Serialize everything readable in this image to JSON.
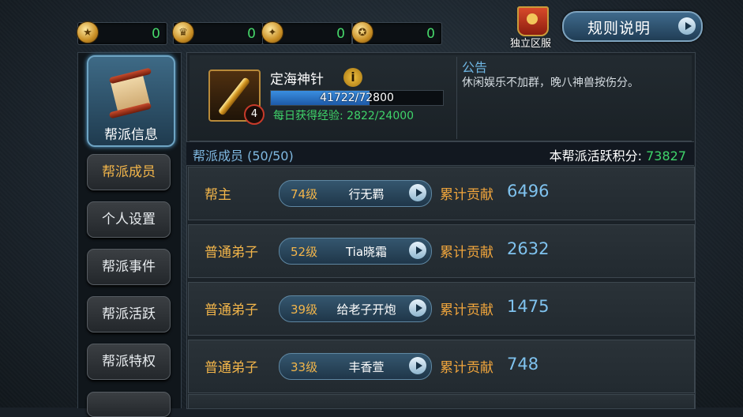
{
  "currencies": [
    {
      "icon": "coin-icon",
      "value": "0"
    },
    {
      "icon": "helmet-icon",
      "value": "0"
    },
    {
      "icon": "emblem-icon",
      "value": "0"
    },
    {
      "icon": "medal-icon",
      "value": "0"
    }
  ],
  "top_right": {
    "server_label": "独立区服",
    "rules_label": "规则说明"
  },
  "nav": {
    "header_label": "帮派信息",
    "items": [
      {
        "label": "帮派成员",
        "active": true
      },
      {
        "label": "个人设置",
        "active": false
      },
      {
        "label": "帮派事件",
        "active": false
      },
      {
        "label": "帮派活跃",
        "active": false
      },
      {
        "label": "帮派特权",
        "active": false
      }
    ]
  },
  "guild": {
    "name": "定海神针",
    "level": "4",
    "info_icon_glyph": "i",
    "exp_text": "41722/72800",
    "exp_progress": 0.573,
    "daily_exp": "每日获得经验: 2822/24000"
  },
  "notice": {
    "title": "公告",
    "text": "休闲娱乐不加群，晚八神兽按伤分。"
  },
  "members_header": {
    "title": "帮派成员 (50/50)",
    "activity_label": "本帮派活跃积分: ",
    "activity_value": "73827"
  },
  "members": [
    {
      "role": "帮主",
      "level": "74级",
      "name": "行无羁",
      "contrib_label": "累计贡献",
      "contrib": "6496"
    },
    {
      "role": "普通弟子",
      "level": "52级",
      "name": "Tia晓霜",
      "contrib_label": "累计贡献",
      "contrib": "2632"
    },
    {
      "role": "普通弟子",
      "level": "39级",
      "name": "给老子开炮",
      "contrib_label": "累计贡献",
      "contrib": "1475"
    },
    {
      "role": "普通弟子",
      "level": "33级",
      "name": "丰香萱",
      "contrib_label": "累计贡献",
      "contrib": "748"
    }
  ]
}
